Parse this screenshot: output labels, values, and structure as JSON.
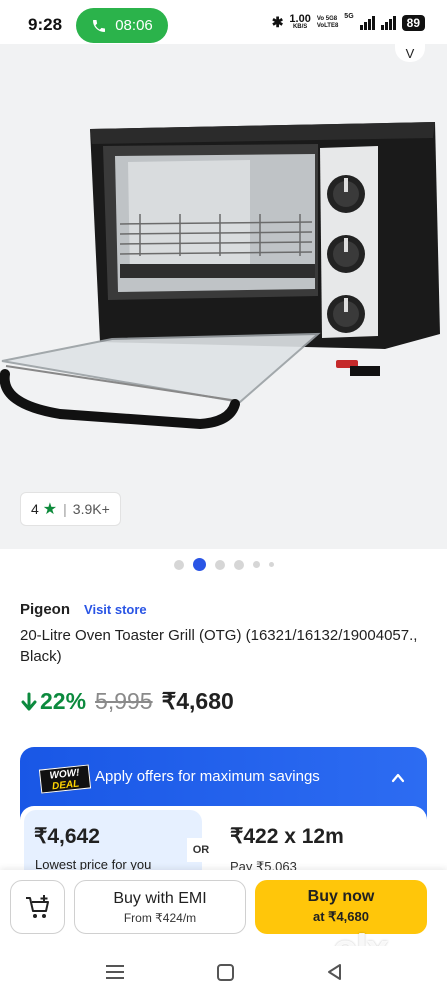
{
  "status_bar": {
    "time": "9:28",
    "call_time": "08:06",
    "net_speed": "1.00",
    "net_speed_unit": "KB/S",
    "volte_1": "Vo 5G8",
    "volte_2": "VoLTE8",
    "network": "5G",
    "battery": "89"
  },
  "gallery": {
    "rating": "4",
    "rating_icon": "star-icon",
    "rating_count": "3.9K+",
    "active_index": 1,
    "dot_count": 6
  },
  "product": {
    "brand": "Pigeon",
    "visit_store": "Visit store",
    "title": "20-Litre Oven Toaster Grill (OTG) (16321/16132/19004057., Black)",
    "discount": "22%",
    "mrp": "5,995",
    "price": "₹4,680"
  },
  "offers": {
    "badge_line1": "WOW!",
    "badge_line2": "DEAL",
    "title": "Apply offers for maximum savings",
    "option1_amount": "₹4,642",
    "option1_sub": "Lowest price for you",
    "or_label": "OR",
    "option2_amount": "₹422 x 12m",
    "option2_sub": "Pay ₹5,063"
  },
  "actions": {
    "emi_label": "Buy with EMI",
    "emi_sub": "From ₹424/m",
    "buy_label": "Buy now",
    "buy_sub": "at ₹4,680"
  },
  "watermark": "olx",
  "colors": {
    "accent_blue": "#2a55e5",
    "discount_green": "#0c8a3e",
    "buy_yellow": "#ffc60a",
    "call_green": "#2bb34b"
  }
}
